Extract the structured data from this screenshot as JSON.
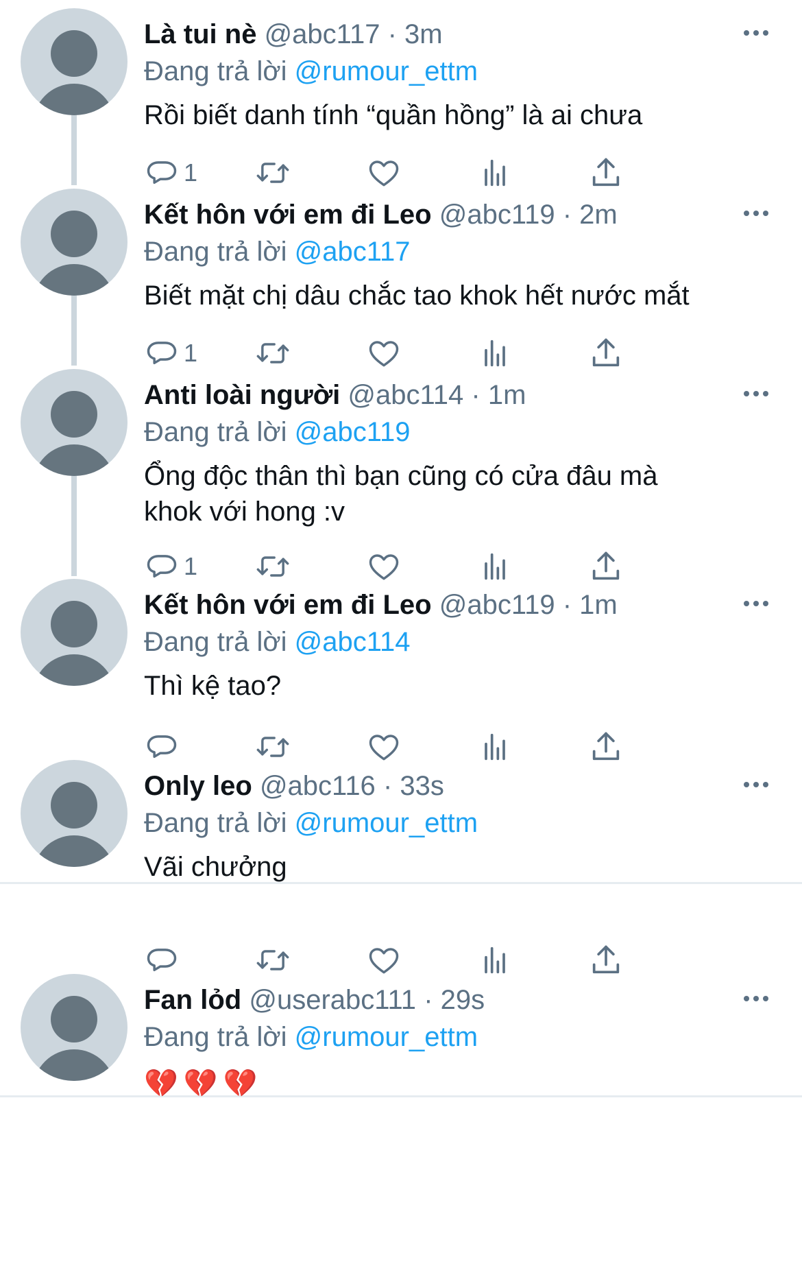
{
  "reply_prefix": "Đang trả lời",
  "tweets": [
    {
      "name": "Là tui nè",
      "handle": "@abc117",
      "separator": "·",
      "time": "3m",
      "reply_to": "@rumour_ettm",
      "text": "Rồi biết danh tính “quần hồng” là ai chưa",
      "reply_count": "1"
    },
    {
      "name": "Kết hôn với em đi Leo",
      "handle": "@abc119",
      "separator": "·",
      "time": "2m",
      "reply_to": "@abc117",
      "text": "Biết mặt chị dâu chắc tao khok hết nước mắt",
      "reply_count": "1"
    },
    {
      "name": "Anti loài người",
      "handle": "@abc114",
      "separator": "·",
      "time": "1m",
      "reply_to": "@abc119",
      "text": "Ổng độc thân thì bạn cũng có cửa đâu mà khok với hong :v",
      "reply_count": "1"
    },
    {
      "name": "Kết hôn với em đi Leo",
      "handle": "@abc119",
      "separator": "·",
      "time": "1m",
      "reply_to": "@abc114",
      "text": "Thì kệ tao?",
      "reply_count": ""
    },
    {
      "name": "Only leo",
      "handle": "@abc116",
      "separator": "·",
      "time": "33s",
      "reply_to": "@rumour_ettm",
      "text": "Vãi chưởng",
      "reply_count": ""
    },
    {
      "name": "Fan lỏd",
      "handle": "@userabc111",
      "separator": "·",
      "time": "29s",
      "reply_to": "@rumour_ettm",
      "text": "💔💔💔",
      "reply_count": ""
    }
  ],
  "icons": [
    "reply-icon",
    "retweet-icon",
    "like-icon",
    "analytics-icon",
    "share-icon",
    "more-icon"
  ],
  "colors": {
    "link": "#1da1f2",
    "secondary": "#5b7083",
    "avatar_bg": "#ccd6dd",
    "avatar_fg": "#66757f",
    "separator": "#e6ecf0"
  }
}
